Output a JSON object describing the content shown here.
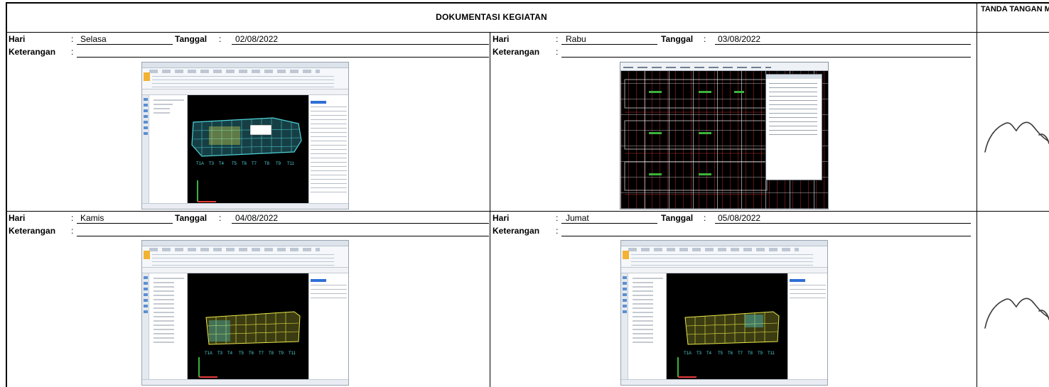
{
  "header": {
    "title": "DOKUMENTASI KEGIATAN",
    "sign_title": "TANDA TANGAN MENTOR"
  },
  "labels": {
    "day": "Hari",
    "date": "Tanggal",
    "note": "Keterangan",
    "colon": ":"
  },
  "entries": [
    {
      "day": "Selasa",
      "date": "02/08/2022",
      "note": ""
    },
    {
      "day": "Rabu",
      "date": "03/08/2022",
      "note": ""
    },
    {
      "day": "Kamis",
      "date": "04/08/2022",
      "note": ""
    },
    {
      "day": "Jumat",
      "date": "05/08/2022",
      "note": ""
    }
  ],
  "colors": {
    "cad_background": "#000000",
    "slab_yellow": "#e9e94a",
    "slab_cyan": "#4fd3d8",
    "accent_blue": "#2f6fd6"
  }
}
